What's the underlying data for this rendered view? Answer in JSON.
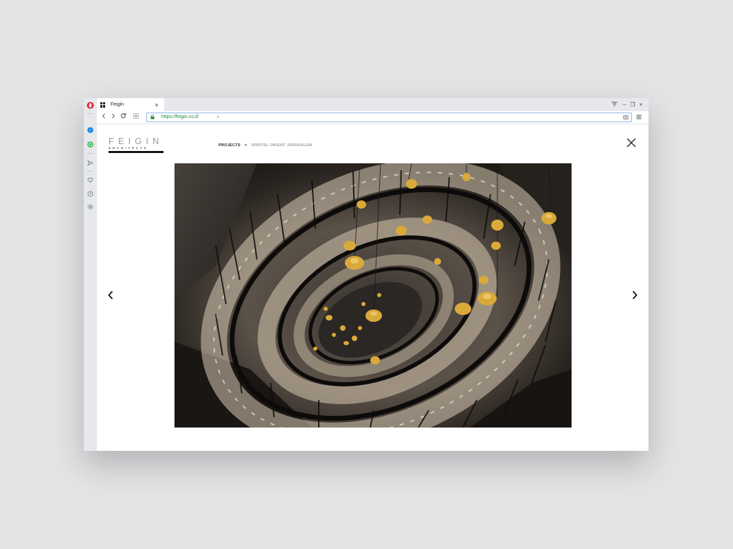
{
  "browser": {
    "tab_title": "Feigin",
    "tab_close": "×",
    "url": "https://feigin.co.il/",
    "url_clear": "×",
    "window_controls": [
      "–",
      "❐",
      "×"
    ]
  },
  "site": {
    "logo_name": "FEIGIN",
    "logo_sub": "ARCHITECTS",
    "breadcrumb": {
      "projects": "PROJECTS",
      "separator": ">",
      "current": "ISROTEL ORIENT JERUSALEM"
    }
  },
  "icons": {
    "close": "close-icon",
    "prev": "chevron-left-icon",
    "next": "chevron-right-icon"
  },
  "colors": {
    "url_green": "#1e8a3c",
    "url_border": "#8fb6e8",
    "breadcrumb_muted": "#9b9b9b",
    "opera_red": "#e0242b",
    "messenger_blue": "#1e88e5",
    "whatsapp_green": "#2fb84f"
  }
}
